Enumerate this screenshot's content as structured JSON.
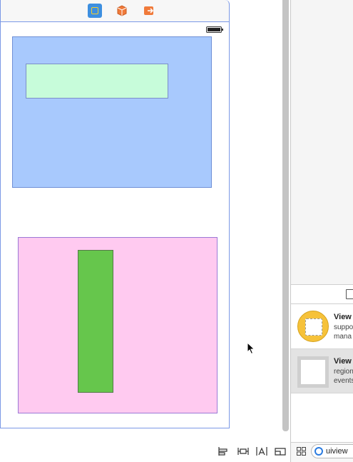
{
  "scene_dock": {
    "icons": [
      "view-controller-icon",
      "first-responder-icon",
      "exit-icon"
    ],
    "accent": "#3d8fe0"
  },
  "canvas": {
    "status_bar_icon": "battery-icon",
    "views": [
      {
        "name": "blue-view",
        "color": "#a8c9fd"
      },
      {
        "name": "mint-view",
        "color": "#c7fcda"
      },
      {
        "name": "pink-view",
        "color": "#ffcaf0"
      },
      {
        "name": "green-view",
        "color": "#66c64c"
      }
    ]
  },
  "layout_toolbar": {
    "icons": [
      "align-icon",
      "pin-icon",
      "resolve-icon",
      "resizing-icon"
    ]
  },
  "library": {
    "items": [
      {
        "title": "View",
        "desc1": "suppo",
        "desc2": "mana",
        "icon": "view-controller-object-icon"
      },
      {
        "title": "View",
        "desc1": "region",
        "desc2": "events",
        "icon": "view-object-icon"
      }
    ],
    "filter": {
      "value": "uiview"
    }
  }
}
